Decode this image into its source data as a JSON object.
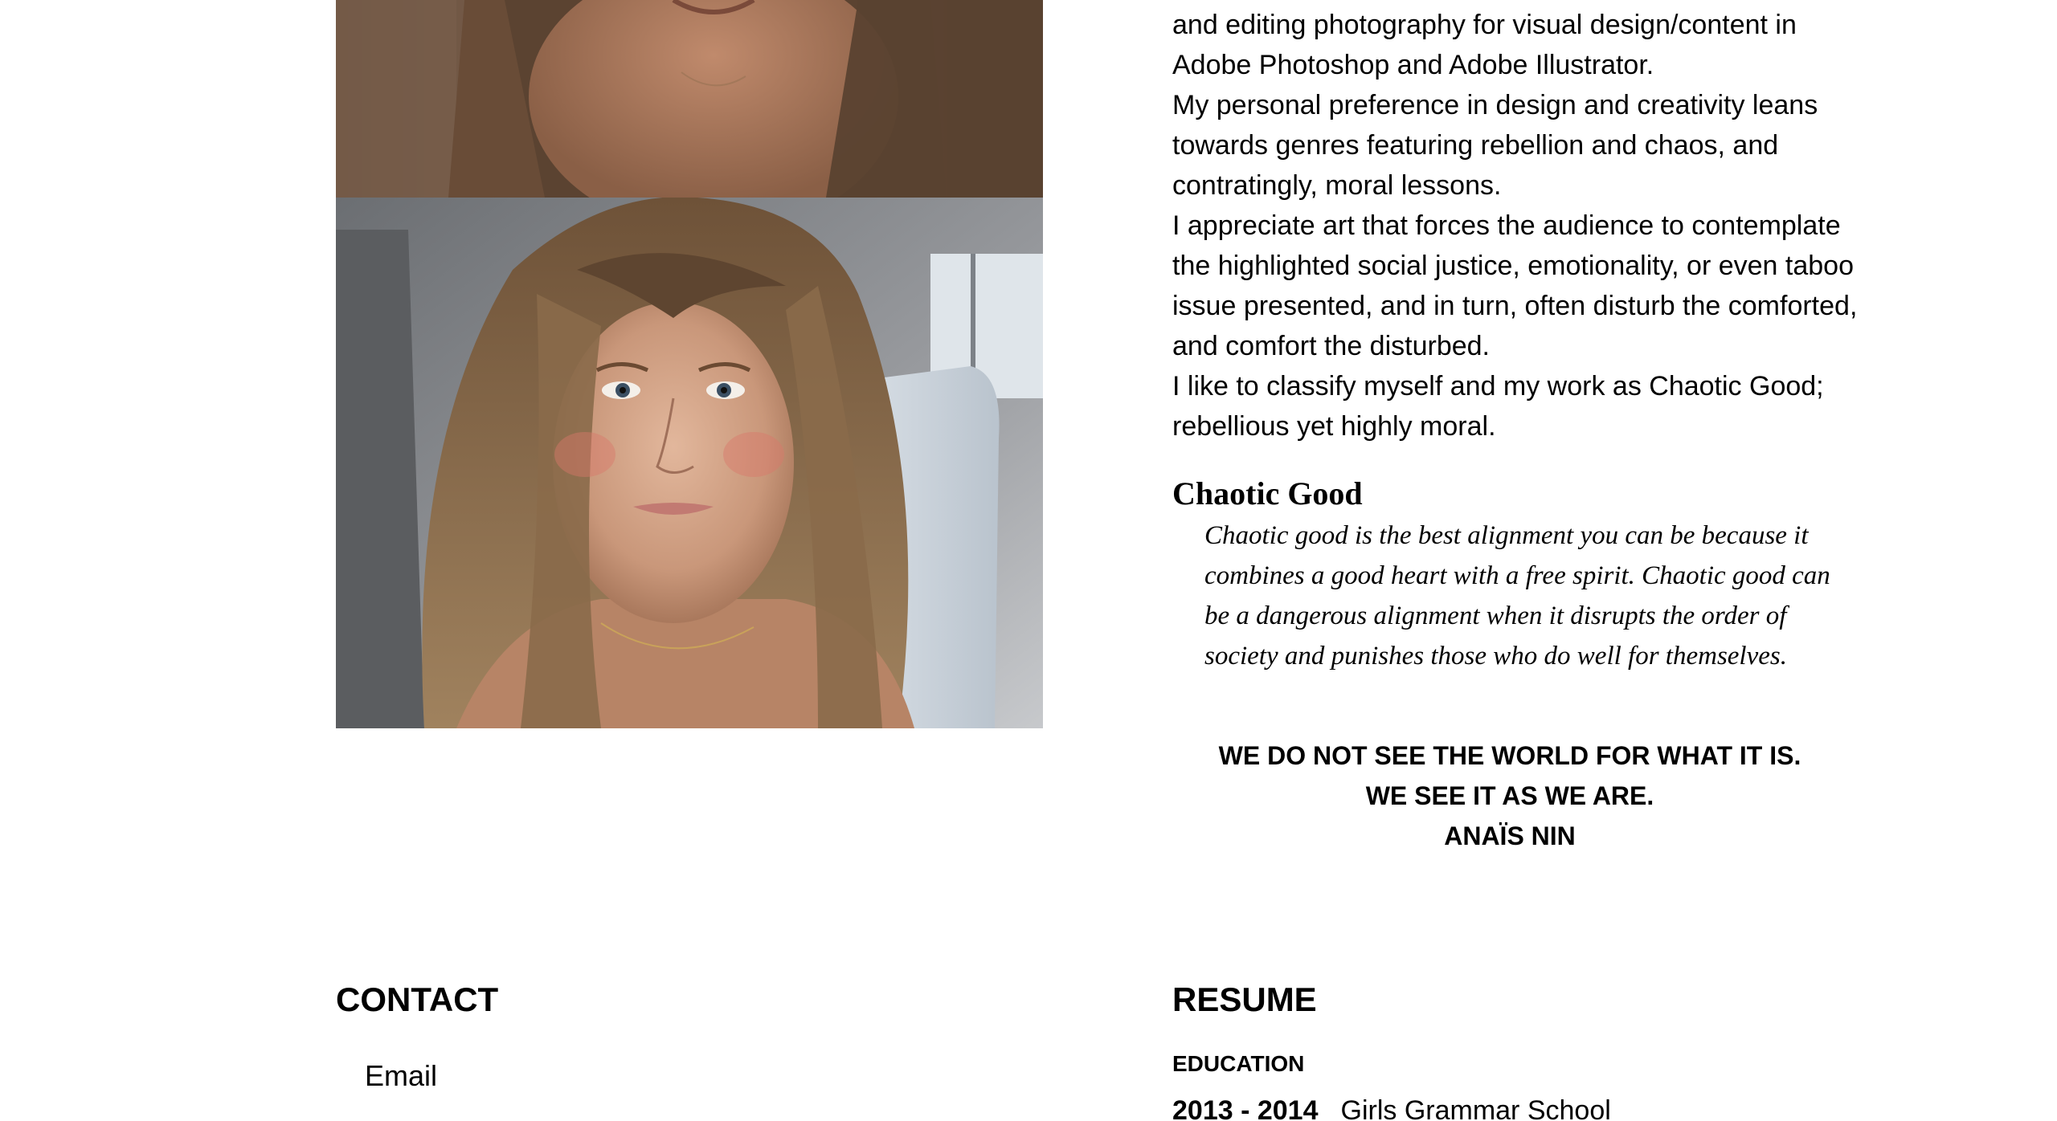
{
  "bio": {
    "paragraphs": [
      "and editing photography for visual design/content in Adobe Photoshop and Adobe Illustrator.",
      "My personal preference in design and creativity leans towards genres featuring rebellion and chaos, and contratingly, moral lessons.",
      "I appreciate art that forces the audience to contemplate the highlighted social justice, emotionality, or even taboo issue presented, and in turn, often disturb the comforted, and comfort the disturbed.",
      "I like to classify myself and my work as Chaotic Good; rebellious yet highly moral."
    ]
  },
  "chaotic_good": {
    "heading": "Chaotic Good",
    "quote": "Chaotic good is the best alignment you can be because it combines a good heart with a free spirit. Chaotic good can be a dangerous alignment when it disrupts the order of society and punishes those who do well for themselves."
  },
  "nin_quote": {
    "line1": "WE DO NOT SEE THE WORLD FOR WHAT IT IS.",
    "line2": "WE SEE IT AS WE ARE.",
    "author": "ANAÏS NIN"
  },
  "contact": {
    "title": "CONTACT",
    "email_label": "Email"
  },
  "resume": {
    "title": "RESUME",
    "education_heading": "EDUCATION",
    "education": [
      {
        "years": "2013 - 2014",
        "school": "Girls Grammar School"
      }
    ]
  },
  "photos": [
    {
      "name": "portrait-photo-top"
    },
    {
      "name": "portrait-photo-bottom"
    }
  ]
}
